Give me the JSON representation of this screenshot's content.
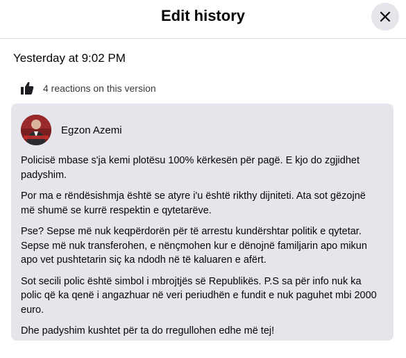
{
  "dialog": {
    "title": "Edit history",
    "close_label": "Close"
  },
  "version": {
    "timestamp": "Yesterday at 9:02 PM",
    "reactions_text": "4 reactions on this version",
    "author": "Egzon Azemi",
    "paragraphs": [
      "Policisë mbase s'ja kemi plotësu 100% kërkesën për pagë. E kjo do zgjidhet padyshim.",
      "Por ma e rëndësishmja është se atyre i'u është rikthy dijniteti. Ata sot gëzojnë më shumë se kurrë respektin e qytetarëve.",
      "Pse? Sepse më nuk keqpërdorën për të arrestu kundërshtar politik e qytetar. Sepse më nuk transferohen, e nënçmohen kur e dënojnë familjarin apo mikun apo vet pushtetarin siç ka ndodh në të kaluaren e afërt.",
      "Sot secili polic është simbol i mbrojtjës së Republikës. P.S sa për info nuk ka polic që ka qenë i angazhuar në veri periudhën e fundit e nuk paguhet mbi 2000 euro.",
      "Dhe padyshim kushtet për ta do rregullohen edhe më tej!"
    ]
  },
  "colors": {
    "card_bg": "#e4e6eb",
    "close_bg": "#e4e6eb",
    "divider": "#dadde1",
    "text": "#050505"
  },
  "icons": {
    "close": "close-icon",
    "reaction": "thumbs-up-icon"
  }
}
